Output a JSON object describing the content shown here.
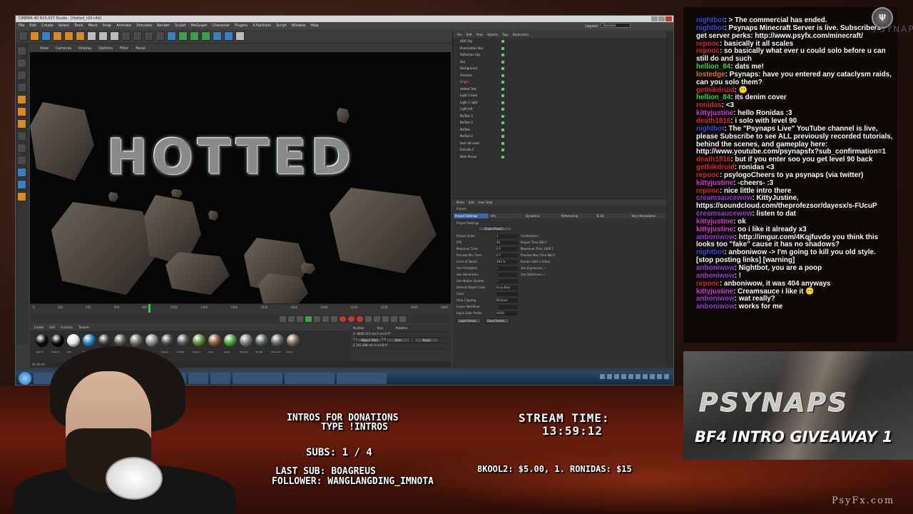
{
  "c4d": {
    "title": "CINEMA 4D R15.037 Studio - [Hotted_r20.c4d]",
    "menu": [
      "File",
      "Edit",
      "Create",
      "Select",
      "Tools",
      "Mesh",
      "Snap",
      "Animate",
      "Simulate",
      "Render",
      "Sculpt",
      "MoGraph",
      "Character",
      "Plugins",
      "X-Particles",
      "Script",
      "Window",
      "Help"
    ],
    "layout_label": "Layout:",
    "layout_value": "Standard",
    "viewport_menu": [
      "View",
      "Cameras",
      "Display",
      "Options",
      "Filter",
      "Panel"
    ],
    "viewport_text": "HOTTED",
    "timeline_ticks": [
      "0",
      "200",
      "400",
      "600",
      "800",
      "1000",
      "1200",
      "1400",
      "1600",
      "1800",
      "2000",
      "2200",
      "2400",
      "2600",
      "2800"
    ],
    "frame_start": "0 F",
    "frame_end": "882 F",
    "material_menu": [
      "Create",
      "Edit",
      "Function",
      "Texture"
    ],
    "material_names": [
      "Light M",
      "Reflect I",
      "Mat",
      "Mat",
      "Mat",
      "Mat",
      "Mat",
      "Mat",
      "Raised",
      "Rubber",
      "Organic",
      "Lava",
      "Green",
      "Dangerl",
      "Tel Mat",
      "Textured",
      "Rusty"
    ],
    "material_colors": [
      "#111111",
      "#0a0a0a",
      "#e8e8e8",
      "#2a7fc0",
      "#3a3a3a",
      "#555555",
      "#6a6a6a",
      "#8a8a8a",
      "#4a4a4a",
      "#555555",
      "#5a8a3a",
      "#8a5a3a",
      "#4aa040",
      "#7a7a7a",
      "#556655",
      "#666666",
      "#7a6a5a"
    ],
    "coord_headers": [
      "Position",
      "Size",
      "Rotation"
    ],
    "coord_rows": [
      "X  -4949.313 cm   0 cm   H  0°",
      "Y  241.213 cm   0 cm   P  90°",
      "Z  192.498 cm   0 cm   B  0°"
    ],
    "coord_buttons": [
      "Object (Rel)",
      "Size",
      "Apply"
    ],
    "status": "00:00:00",
    "obj_menu": [
      "File",
      "Edit",
      "View",
      "Objects",
      "Tags",
      "Bookmarks"
    ],
    "objects": [
      "HDR Sky",
      "Illumination Sky",
      "Reflection Sky",
      "Sky",
      "Background",
      "Particles",
      "Origin",
      "Hotted Text",
      "Light 2 back",
      "Light 1 right",
      "Light left",
      "MoText 3",
      "MoText 4",
      "MoText",
      "MoText 2",
      "text not used",
      "Extrude 2",
      "Main Pieces"
    ],
    "attr_menu": [
      "Mode",
      "Edit",
      "User Data"
    ],
    "attr_title": "Project",
    "attr_tabs": [
      "Project Settings",
      "Info",
      "Dynamics",
      "Referencing",
      "To Do",
      "Key Interpolation"
    ],
    "attr_section": "Project Settings",
    "attr_rows": [
      {
        "label": "Project Scale",
        "value": "1",
        "extra": "Centimeters"
      },
      {
        "label": "FPS",
        "value": "30",
        "extra": "Project Time  882 F"
      },
      {
        "label": "Minimum Time",
        "value": "0 F",
        "extra": "Maximum Time  3000 F"
      },
      {
        "label": "Preview Min Time",
        "value": "0 F",
        "extra": "Preview Max Time  882 F"
      },
      {
        "label": "Level of Detail",
        "value": "100 %",
        "extra": "Render LOD in Editor"
      },
      {
        "label": "Use Animation",
        "value": "✓",
        "extra": "Use Expression ✓"
      },
      {
        "label": "Use Generators",
        "value": "✓",
        "extra": "Use Deformers ✓"
      },
      {
        "label": "Use Motion System",
        "value": "✓",
        "extra": ""
      },
      {
        "label": "Default Object Color",
        "value": "Gray-Blue",
        "extra": ""
      },
      {
        "label": "Color",
        "value": "",
        "extra": ""
      },
      {
        "label": "View Clipping",
        "value": "Medium",
        "extra": ""
      },
      {
        "label": "Linear Workflow",
        "value": "✓",
        "extra": ""
      },
      {
        "label": "Input Color Profile",
        "value": "sRGB",
        "extra": ""
      }
    ],
    "attr_buttons": [
      "Load Preset...",
      "Save Preset..."
    ],
    "scale_button": "Scale Project..."
  },
  "chat": [
    {
      "user": "nightbot",
      "color": "#3a4ad8",
      "msg": ": > The commercial has ended."
    },
    {
      "user": "nightbot",
      "color": "#3a4ad8",
      "msg": ": Psynaps Minecraft Server is live. Subscribers get server perks: http://www.psyfx.com/minecraft/"
    },
    {
      "user": "repooc",
      "color": "#d82a2a",
      "msg": ": basically it all scales"
    },
    {
      "user": "repooc",
      "color": "#d82a2a",
      "msg": ": so basically what ever u could solo before u can still do and such"
    },
    {
      "user": "hellion_84",
      "color": "#3ad83a",
      "msg": ": dats me!"
    },
    {
      "user": "lostedge",
      "color": "#e07a20",
      "msg": ": Psynaps: have you entered any cataclysm raids, can you solo them?"
    },
    {
      "user": "gethikdruid",
      "color": "#d82a2a",
      "msg": ": 😶"
    },
    {
      "user": "hellion_84",
      "color": "#3ad83a",
      "msg": ": its denim cover"
    },
    {
      "user": "ronidas",
      "color": "#d82a2a",
      "msg": ": <3"
    },
    {
      "user": "kittyjustine",
      "color": "#d83ad8",
      "msg": ": hello Ronidas :3"
    },
    {
      "user": "death1816",
      "color": "#d82a2a",
      "msg": ": i solo with level 90"
    },
    {
      "user": "nightbot",
      "color": "#3a4ad8",
      "msg": ": The \"Psynaps Live\" YouTube channel is live, please Subscribe to see ALL previously recorded tutorials, behind the scenes, and gameplay here: http://www.youtube.com/psynapsfx?sub_confirmation=1"
    },
    {
      "user": "death1816",
      "color": "#d82a2a",
      "msg": ": but if you enter soo you get level 90 back"
    },
    {
      "user": "gethikdruid",
      "color": "#d82a2a",
      "msg": ": ronidas <3"
    },
    {
      "user": "repooc",
      "color": "#d82a2a",
      "msg": ": psylogoCheers to ya psynaps (via twitter)"
    },
    {
      "user": "kittyjustine",
      "color": "#d83ad8",
      "msg": ": -cheers- :3"
    },
    {
      "user": "repooc",
      "color": "#d82a2a",
      "msg": ": nice little intro there"
    },
    {
      "user": "creamsaucewow",
      "color": "#9a3ad8",
      "msg": ": KittyJustine, https://soundcloud.com/theprofezsor/dayesx/s-FUcuP"
    },
    {
      "user": "creamsaucewow",
      "color": "#9a3ad8",
      "msg": ": listen to dat"
    },
    {
      "user": "kittyjustine",
      "color": "#d83ad8",
      "msg": ": ok"
    },
    {
      "user": "kittyjustine",
      "color": "#d83ad8",
      "msg": ": oo i like it already x3"
    },
    {
      "user": "anboniwow",
      "color": "#9a3ad8",
      "msg": ": http://imgur.com/4Kqjfuvdo you think this looks too \"fake\" cause it has no shadows?"
    },
    {
      "user": "nightbot",
      "color": "#3a4ad8",
      "msg": ": anboniwow -> I'm going to kill you old style. [stop posting links] [warning]"
    },
    {
      "user": "anboniwow",
      "color": "#9a3ad8",
      "msg": ": Nightbot, you are a poop"
    },
    {
      "user": "anboniwow",
      "color": "#9a3ad8",
      "msg": ": !"
    },
    {
      "user": "repooc",
      "color": "#d82a2a",
      "msg": ": anboniwow, it was 404 anyways"
    },
    {
      "user": "kittyjustine",
      "color": "#d83ad8",
      "msg": ": Creamsauce i like it 😶"
    },
    {
      "user": "anboniwow",
      "color": "#9a3ad8",
      "msg": ": wat really?"
    },
    {
      "user": "anboniwow",
      "color": "#9a3ad8",
      "msg": ": works for me"
    }
  ],
  "banner": {
    "logo": "PSYNAPS",
    "giveaway": "BF4 INTRO GIVEAWAY 1"
  },
  "corner_brand": "PSYNAPS",
  "overlay": {
    "intros_line1": "INTROS FOR DONATIONS",
    "intros_line2": "TYPE !INTROS",
    "stream_time_label": "STREAM TIME:",
    "stream_time_value": "13:59:12",
    "subs": "SUBS: 1 / 4",
    "last_sub": "LAST SUB: BOAGREUS",
    "follower": "FOLLOWER: WANGLANGDING_IMNOTA",
    "donations": "8KOOL2: $5.00,    1. RONIDAS: $15"
  },
  "watermark": "PsyFx.com"
}
